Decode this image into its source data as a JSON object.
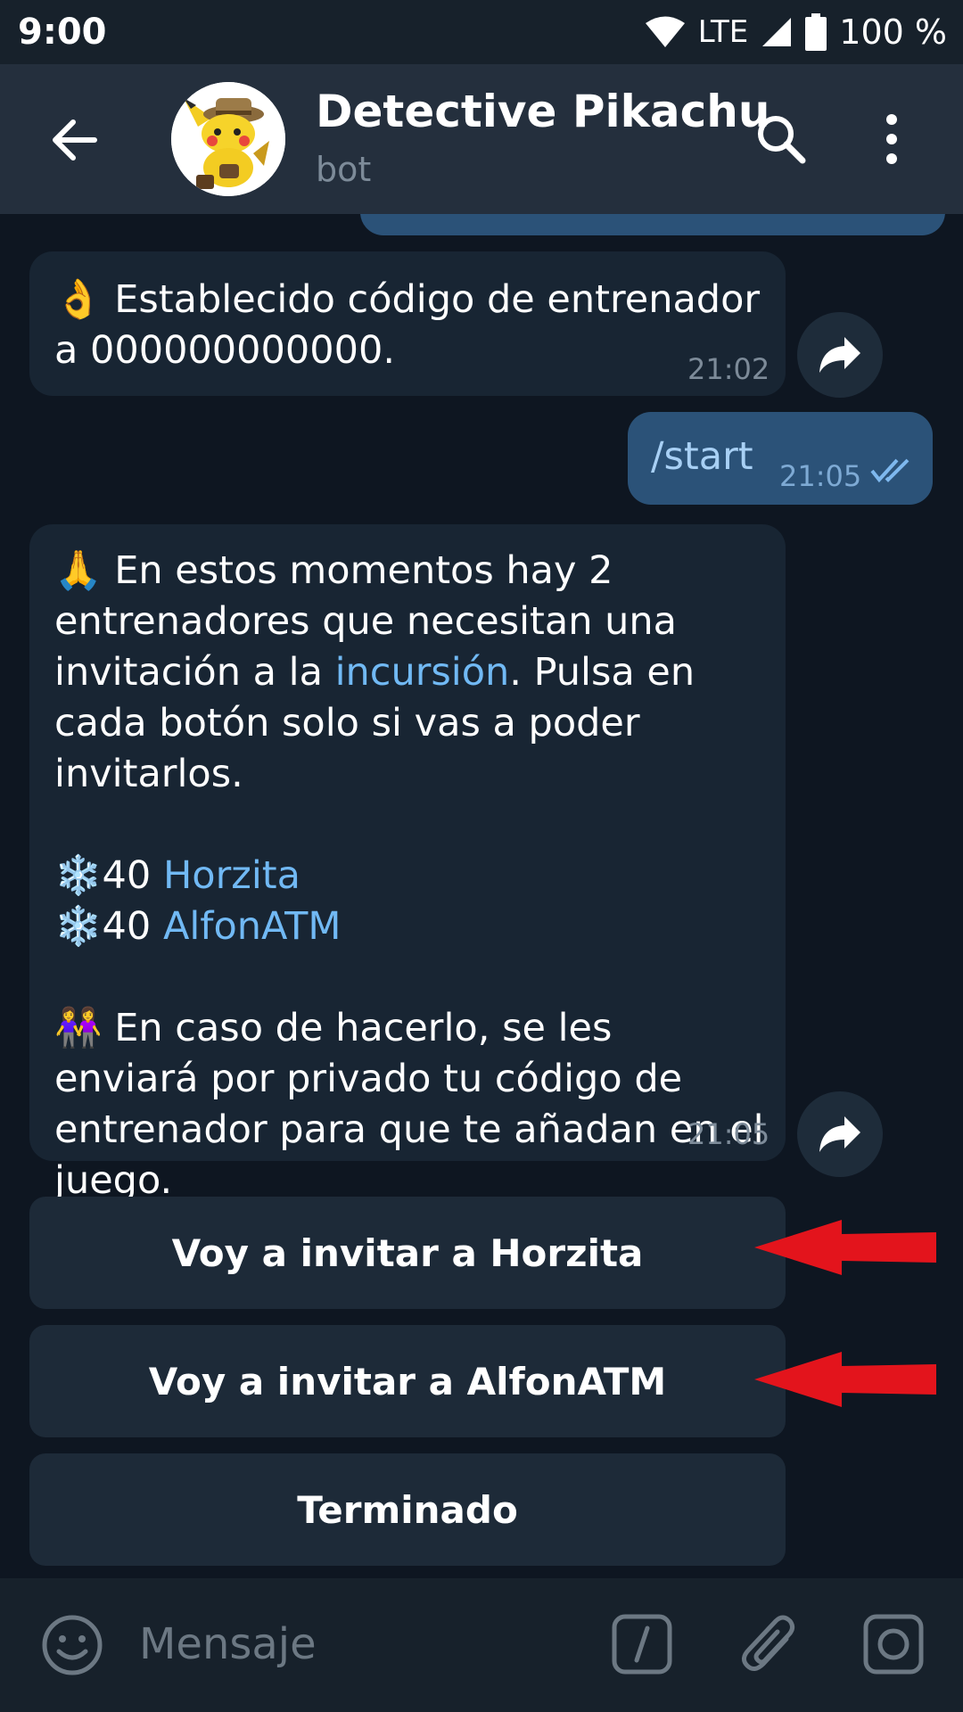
{
  "status_bar": {
    "time": "9:00",
    "network": "LTE",
    "battery": "100 %"
  },
  "header": {
    "title": "Detective Pikachu",
    "subtitle": "bot"
  },
  "messages": {
    "m1": {
      "emoji": "👌",
      "text": " Establecido código de entrenador a 000000000000.",
      "time": "21:02"
    },
    "m2": {
      "text": "/start",
      "time": "21:05"
    },
    "m3": {
      "p1_emoji": "🙏",
      "p1_a": " En estos momentos hay 2 entrenadores que necesitan una invitación a la ",
      "p1_link": "incursión",
      "p1_b": ". Pulsa en cada botón solo si vas a poder invitarlos.",
      "line1_emoji": "❄️",
      "line1_num": "40 ",
      "line1_name": "Horzita",
      "line2_emoji": "❄️",
      "line2_num": "40 ",
      "line2_name": "AlfonATM",
      "p3_emoji": "👭",
      "p3_text": " En caso de hacerlo, se les enviará por privado tu código de entrenador para que te añadan en el juego.",
      "time": "21:05"
    }
  },
  "keyboard": {
    "btn1": "Voy a invitar a Horzita",
    "btn2": "Voy a invitar a AlfonATM",
    "btn3": "Terminado"
  },
  "input": {
    "placeholder": "Mensaje"
  },
  "colors": {
    "header_bg": "#242f3d",
    "chat_bg": "#0e1621",
    "bubble_in": "#182533",
    "bubble_out": "#2b5278",
    "link": "#71b9f4",
    "annotation_arrow": "#e3141c"
  }
}
